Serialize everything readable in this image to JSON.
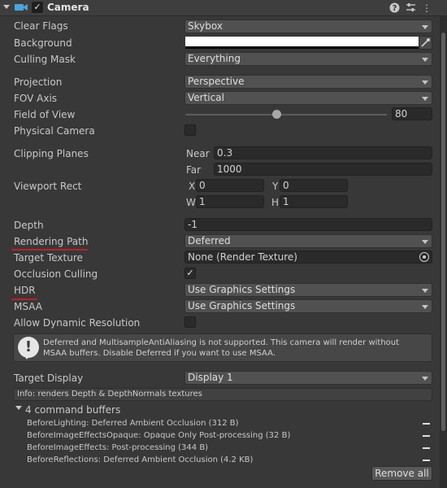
{
  "header": {
    "title": "Camera",
    "enabled": true
  },
  "fields": {
    "clear_flags": {
      "label": "Clear Flags",
      "value": "Skybox"
    },
    "background": {
      "label": "Background",
      "color": "#ffffff"
    },
    "culling_mask": {
      "label": "Culling Mask",
      "value": "Everything"
    },
    "projection": {
      "label": "Projection",
      "value": "Perspective"
    },
    "fov_axis": {
      "label": "FOV Axis",
      "value": "Vertical"
    },
    "field_of_view": {
      "label": "Field of View",
      "value": "80",
      "slider_fraction": 0.45
    },
    "physical_camera": {
      "label": "Physical Camera",
      "checked": false
    },
    "clipping_planes": {
      "label": "Clipping Planes",
      "near_label": "Near",
      "near": "0.3",
      "far_label": "Far",
      "far": "1000"
    },
    "viewport_rect": {
      "label": "Viewport Rect",
      "x_label": "X",
      "x": "0",
      "y_label": "Y",
      "y": "0",
      "w_label": "W",
      "w": "1",
      "h_label": "H",
      "h": "1"
    },
    "depth": {
      "label": "Depth",
      "value": "-1"
    },
    "rendering_path": {
      "label": "Rendering Path",
      "value": "Deferred"
    },
    "target_texture": {
      "label": "Target Texture",
      "value": "None (Render Texture)"
    },
    "occlusion_culling": {
      "label": "Occlusion Culling",
      "checked": true
    },
    "hdr": {
      "label": "HDR",
      "value": "Use Graphics Settings"
    },
    "msaa": {
      "label": "MSAA",
      "value": "Use Graphics Settings"
    },
    "allow_dynamic_resolution": {
      "label": "Allow Dynamic Resolution",
      "checked": false
    },
    "target_display": {
      "label": "Target Display",
      "value": "Display 1"
    }
  },
  "warning": {
    "text": "Deferred and MultisampleAntiAliasing is not supported. This camera will render without MSAA buffers. Disable Deferred if you want to use MSAA."
  },
  "info": {
    "text": "Info: renders Depth & DepthNormals textures"
  },
  "command_buffers": {
    "title": "4 command buffers",
    "items": [
      "BeforeLighting: Deferred Ambient Occlusion (312 B)",
      "BeforeImageEffectsOpaque: Opaque Only Post-processing (32 B)",
      "BeforeImageEffects: Post-processing (344 B)",
      "BeforeReflections: Deferred Ambient Occlusion (4.2 KB)"
    ],
    "remove_all_label": "Remove all"
  },
  "colors": {
    "annotation_underline": "#c0202a",
    "panel_bg": "#383838"
  }
}
